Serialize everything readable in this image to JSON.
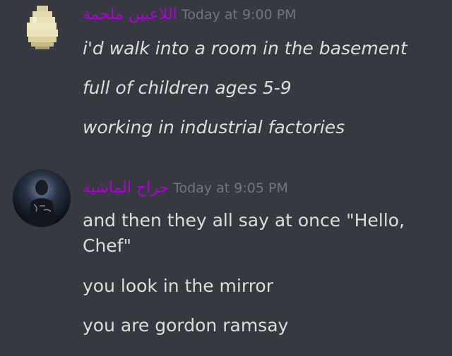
{
  "messages": [
    {
      "author": "اللاعبين ملحمة",
      "timestamp": "Today at 9:00 PM",
      "avatar_icon": "pixel-egg-icon",
      "lines": [
        "i'd walk into a room in the basement",
        "full of children ages 5-9",
        "working in industrial factories"
      ]
    },
    {
      "author": "جراح الماشية",
      "timestamp": "Today at 9:05 PM",
      "avatar_icon": "dark-portrait-icon",
      "lines": [
        "and then they all say at once \"Hello, Chef\"",
        "you look in the mirror",
        "you are gordon ramsay"
      ]
    }
  ],
  "colors": {
    "background": "#36393f",
    "username": "#b000d9",
    "timestamp": "#72767d",
    "text": "#dcddde"
  }
}
